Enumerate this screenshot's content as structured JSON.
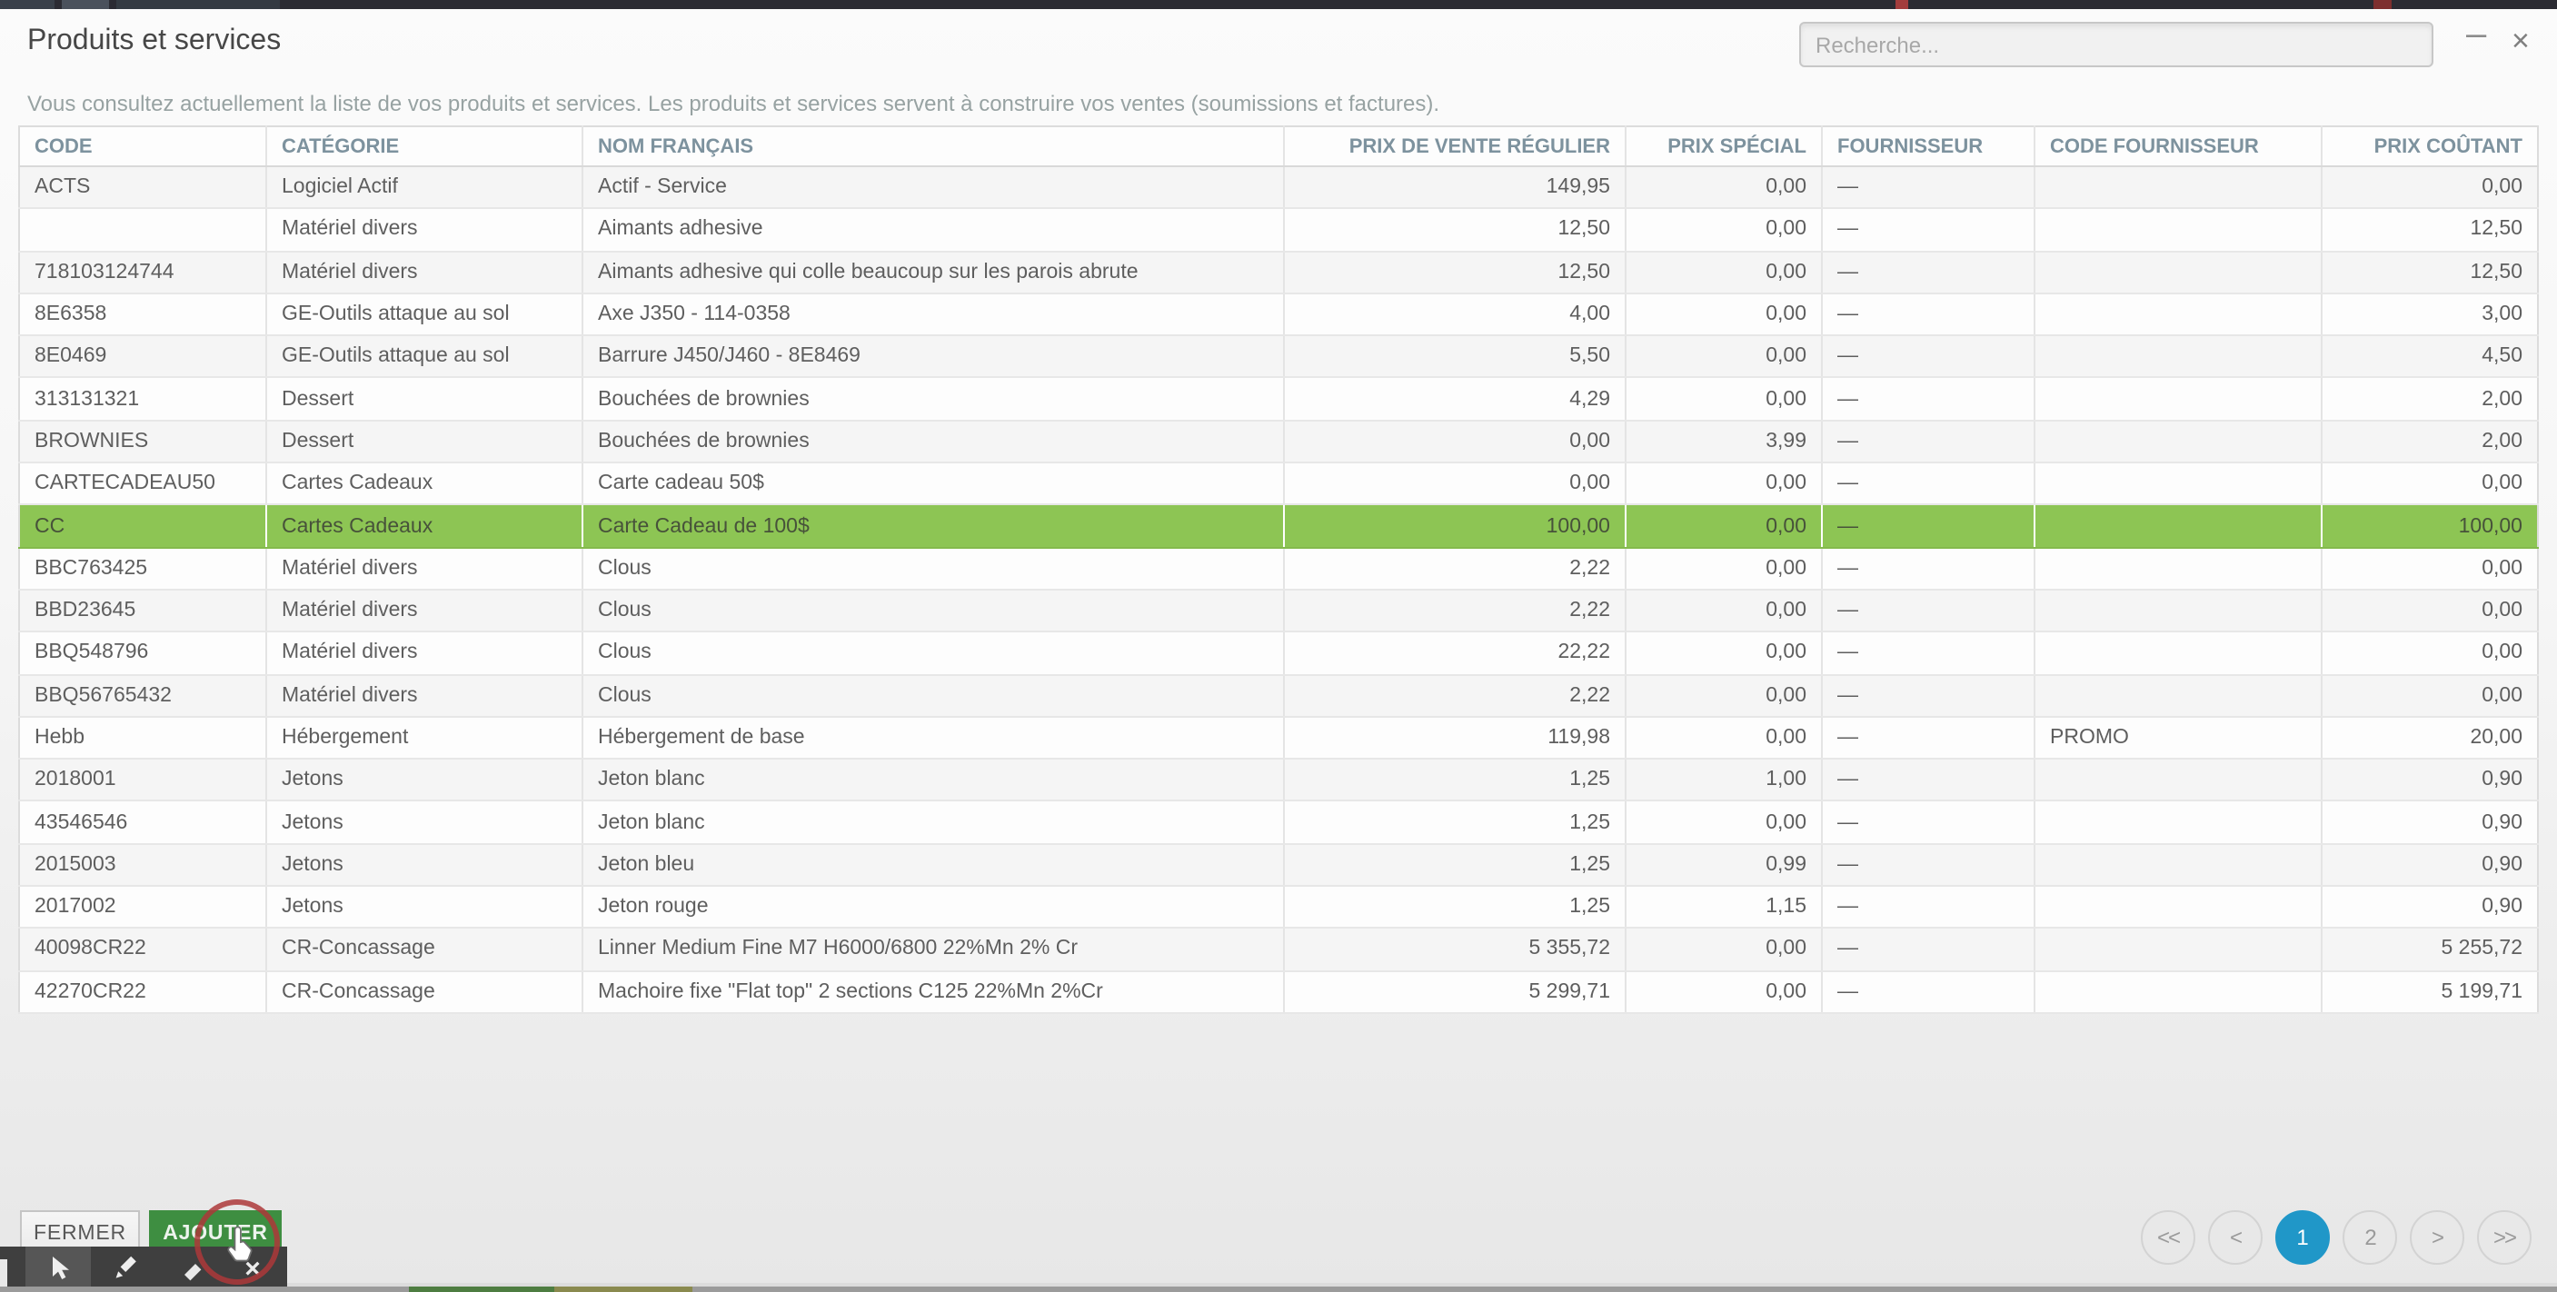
{
  "window": {
    "title": "Produits et services",
    "subtitle": "Vous consultez actuellement la liste de vos produits et services. Les produits et services servent à construire vos ventes (soumissions et factures).",
    "minimize_glyph": "–",
    "close_glyph": "×"
  },
  "search": {
    "placeholder": "Recherche...",
    "value": ""
  },
  "table": {
    "columns": [
      {
        "key": "code",
        "label": "CODE"
      },
      {
        "key": "categorie",
        "label": "CATÉGORIE"
      },
      {
        "key": "nom_francais",
        "label": "NOM FRANÇAIS"
      },
      {
        "key": "prix_vente_regulier",
        "label": "PRIX DE VENTE RÉGULIER"
      },
      {
        "key": "prix_special",
        "label": "PRIX SPÉCIAL"
      },
      {
        "key": "fournisseur",
        "label": "FOURNISSEUR"
      },
      {
        "key": "code_fournisseur",
        "label": "CODE FOURNISSEUR"
      },
      {
        "key": "prix_coutant",
        "label": "PRIX COÛTANT"
      }
    ],
    "rows": [
      {
        "code": "ACTS",
        "categorie": "Logiciel Actif",
        "nom_francais": "Actif - Service",
        "prix_vente_regulier": "149,95",
        "prix_special": "0,00",
        "fournisseur": "—",
        "code_fournisseur": "",
        "prix_coutant": "0,00",
        "selected": false
      },
      {
        "code": "",
        "categorie": "Matériel divers",
        "nom_francais": "Aimants adhesive",
        "prix_vente_regulier": "12,50",
        "prix_special": "0,00",
        "fournisseur": "—",
        "code_fournisseur": "",
        "prix_coutant": "12,50",
        "selected": false
      },
      {
        "code": "718103124744",
        "categorie": "Matériel divers",
        "nom_francais": "Aimants adhesive qui colle beaucoup sur les parois abrute",
        "prix_vente_regulier": "12,50",
        "prix_special": "0,00",
        "fournisseur": "—",
        "code_fournisseur": "",
        "prix_coutant": "12,50",
        "selected": false
      },
      {
        "code": "8E6358",
        "categorie": "GE-Outils attaque au sol",
        "nom_francais": "Axe J350 - 114-0358",
        "prix_vente_regulier": "4,00",
        "prix_special": "0,00",
        "fournisseur": "—",
        "code_fournisseur": "",
        "prix_coutant": "3,00",
        "selected": false
      },
      {
        "code": "8E0469",
        "categorie": "GE-Outils attaque au sol",
        "nom_francais": "Barrure J450/J460 - 8E8469",
        "prix_vente_regulier": "5,50",
        "prix_special": "0,00",
        "fournisseur": "—",
        "code_fournisseur": "",
        "prix_coutant": "4,50",
        "selected": false
      },
      {
        "code": "313131321",
        "categorie": "Dessert",
        "nom_francais": "Bouchées de brownies",
        "prix_vente_regulier": "4,29",
        "prix_special": "0,00",
        "fournisseur": "—",
        "code_fournisseur": "",
        "prix_coutant": "2,00",
        "selected": false
      },
      {
        "code": "BROWNIES",
        "categorie": "Dessert",
        "nom_francais": "Bouchées de brownies",
        "prix_vente_regulier": "0,00",
        "prix_special": "3,99",
        "fournisseur": "—",
        "code_fournisseur": "",
        "prix_coutant": "2,00",
        "selected": false
      },
      {
        "code": "CARTECADEAU50",
        "categorie": "Cartes Cadeaux",
        "nom_francais": "Carte cadeau 50$",
        "prix_vente_regulier": "0,00",
        "prix_special": "0,00",
        "fournisseur": "—",
        "code_fournisseur": "",
        "prix_coutant": "0,00",
        "selected": false
      },
      {
        "code": "CC",
        "categorie": "Cartes Cadeaux",
        "nom_francais": "Carte Cadeau de 100$",
        "prix_vente_regulier": "100,00",
        "prix_special": "0,00",
        "fournisseur": "—",
        "code_fournisseur": "",
        "prix_coutant": "100,00",
        "selected": true
      },
      {
        "code": "BBC763425",
        "categorie": "Matériel divers",
        "nom_francais": "Clous",
        "prix_vente_regulier": "2,22",
        "prix_special": "0,00",
        "fournisseur": "—",
        "code_fournisseur": "",
        "prix_coutant": "0,00",
        "selected": false
      },
      {
        "code": "BBD23645",
        "categorie": "Matériel divers",
        "nom_francais": "Clous",
        "prix_vente_regulier": "2,22",
        "prix_special": "0,00",
        "fournisseur": "—",
        "code_fournisseur": "",
        "prix_coutant": "0,00",
        "selected": false
      },
      {
        "code": "BBQ548796",
        "categorie": "Matériel divers",
        "nom_francais": "Clous",
        "prix_vente_regulier": "22,22",
        "prix_special": "0,00",
        "fournisseur": "—",
        "code_fournisseur": "",
        "prix_coutant": "0,00",
        "selected": false
      },
      {
        "code": "BBQ56765432",
        "categorie": "Matériel divers",
        "nom_francais": "Clous",
        "prix_vente_regulier": "2,22",
        "prix_special": "0,00",
        "fournisseur": "—",
        "code_fournisseur": "",
        "prix_coutant": "0,00",
        "selected": false
      },
      {
        "code": "Hebb",
        "categorie": "Hébergement",
        "nom_francais": "Hébergement de base",
        "prix_vente_regulier": "119,98",
        "prix_special": "0,00",
        "fournisseur": "—",
        "code_fournisseur": "PROMO",
        "prix_coutant": "20,00",
        "selected": false
      },
      {
        "code": "2018001",
        "categorie": "Jetons",
        "nom_francais": "Jeton blanc",
        "prix_vente_regulier": "1,25",
        "prix_special": "1,00",
        "fournisseur": "—",
        "code_fournisseur": "",
        "prix_coutant": "0,90",
        "selected": false
      },
      {
        "code": "43546546",
        "categorie": "Jetons",
        "nom_francais": "Jeton blanc",
        "prix_vente_regulier": "1,25",
        "prix_special": "0,00",
        "fournisseur": "—",
        "code_fournisseur": "",
        "prix_coutant": "0,90",
        "selected": false
      },
      {
        "code": "2015003",
        "categorie": "Jetons",
        "nom_francais": "Jeton bleu",
        "prix_vente_regulier": "1,25",
        "prix_special": "0,99",
        "fournisseur": "—",
        "code_fournisseur": "",
        "prix_coutant": "0,90",
        "selected": false
      },
      {
        "code": "2017002",
        "categorie": "Jetons",
        "nom_francais": "Jeton rouge",
        "prix_vente_regulier": "1,25",
        "prix_special": "1,15",
        "fournisseur": "—",
        "code_fournisseur": "",
        "prix_coutant": "0,90",
        "selected": false
      },
      {
        "code": "40098CR22",
        "categorie": "CR-Concassage",
        "nom_francais": "Linner Medium Fine M7 H6000/6800 22%Mn 2% Cr",
        "prix_vente_regulier": "5 355,72",
        "prix_special": "0,00",
        "fournisseur": "—",
        "code_fournisseur": "",
        "prix_coutant": "5 255,72",
        "selected": false
      },
      {
        "code": "42270CR22",
        "categorie": "CR-Concassage",
        "nom_francais": "Machoire fixe \"Flat top\" 2 sections C125 22%Mn 2%Cr",
        "prix_vente_regulier": "5 299,71",
        "prix_special": "0,00",
        "fournisseur": "—",
        "code_fournisseur": "",
        "prix_coutant": "5 199,71",
        "selected": false
      }
    ]
  },
  "footer": {
    "close_label": "FERMER",
    "add_label": "AJOUTER"
  },
  "pagination": {
    "items": [
      {
        "name": "first-page",
        "label": "<<",
        "active": false
      },
      {
        "name": "prev-page",
        "label": "<",
        "active": false
      },
      {
        "name": "page-1",
        "label": "1",
        "active": true
      },
      {
        "name": "page-2",
        "label": "2",
        "active": false
      },
      {
        "name": "next-page",
        "label": ">",
        "active": false
      },
      {
        "name": "last-page",
        "label": ">>",
        "active": false
      }
    ]
  },
  "colors": {
    "selected_row": "#8dc554",
    "active_page": "#2097c8",
    "add_button": "#3e8e41",
    "click_ring": "#ad383a"
  }
}
